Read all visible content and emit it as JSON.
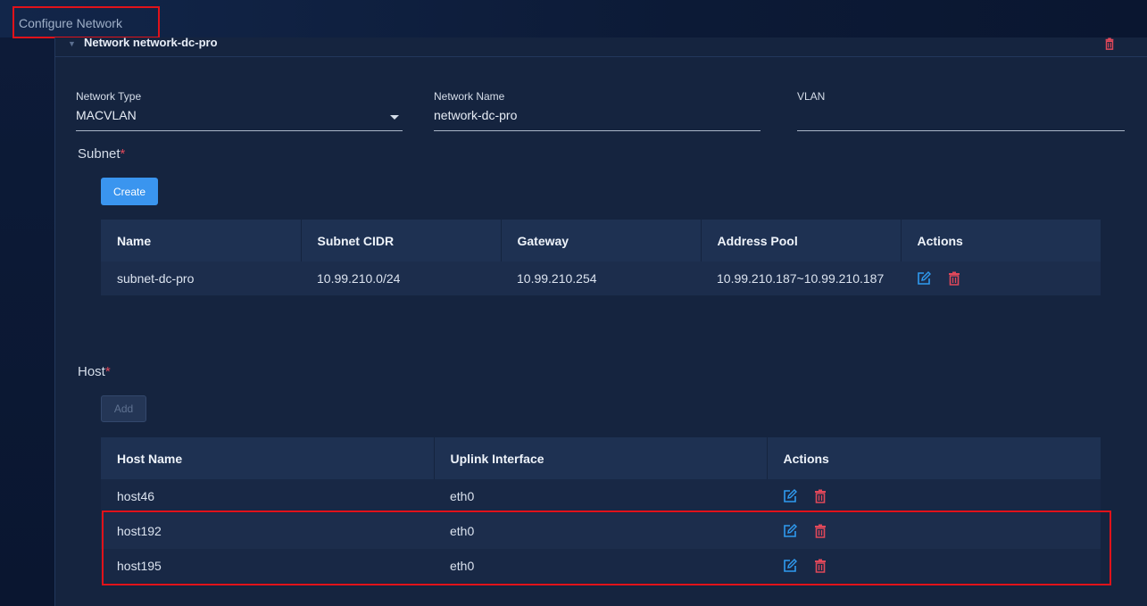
{
  "topbar": {
    "title": "Configure Network"
  },
  "network_panel": {
    "title": "Network network-dc-pro",
    "delete_icon": "trash-icon"
  },
  "form": {
    "network_type": {
      "label": "Network Type",
      "value": "MACVLAN"
    },
    "network_name": {
      "label": "Network Name",
      "value": "network-dc-pro"
    },
    "vlan": {
      "label": "VLAN",
      "value": ""
    }
  },
  "subnet": {
    "label": "Subnet",
    "required_mark": "*",
    "create_label": "Create",
    "columns": [
      "Name",
      "Subnet CIDR",
      "Gateway",
      "Address Pool",
      "Actions"
    ],
    "rows": [
      {
        "name": "subnet-dc-pro",
        "cidr": "10.99.210.0/24",
        "gateway": "10.99.210.254",
        "pool": "10.99.210.187~10.99.210.187"
      }
    ]
  },
  "host": {
    "label": "Host",
    "required_mark": "*",
    "add_label": "Add",
    "columns": [
      "Host Name",
      "Uplink Interface",
      "Actions"
    ],
    "rows": [
      {
        "name": "host46",
        "uplink": "eth0"
      },
      {
        "name": "host192",
        "uplink": "eth0"
      },
      {
        "name": "host195",
        "uplink": "eth0"
      }
    ]
  },
  "colors": {
    "accent": "#3a95ef",
    "danger": "#e0485a",
    "annotation": "#e0121a",
    "edit_icon": "#2f9bf0",
    "trash_icon": "#e0485a"
  },
  "icons": {
    "edit": "edit-icon",
    "delete": "trash-icon"
  }
}
